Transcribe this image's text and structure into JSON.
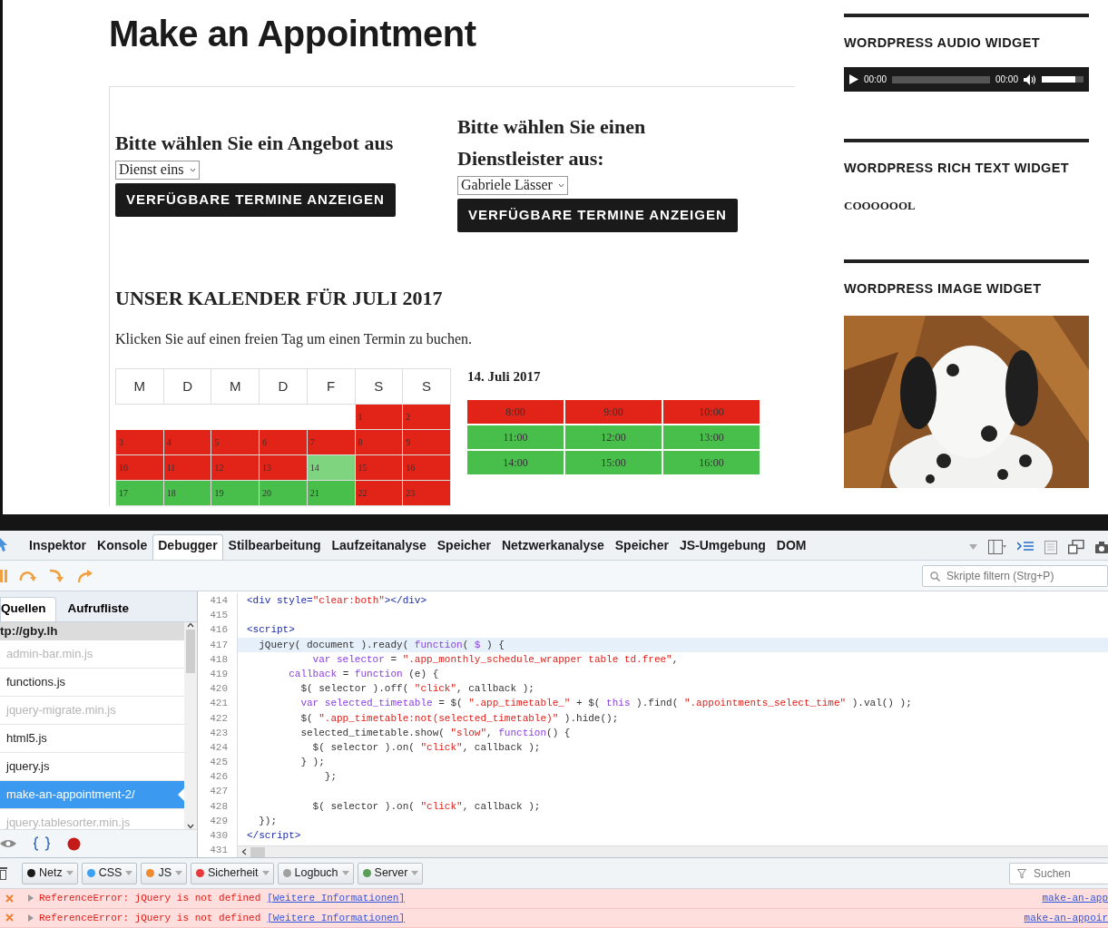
{
  "page": {
    "title": "Make an Appointment",
    "service_picker": {
      "heading": "Bitte wählen Sie ein Angebot aus",
      "select": "Dienst eins",
      "button": "VERFÜGBARE TERMINE ANZEIGEN"
    },
    "provider_picker": {
      "heading": "Bitte wählen Sie einen Dienstleister aus:",
      "select": "Gabriele Lässer",
      "button": "VERFÜGBARE TERMINE ANZEIGEN"
    },
    "calendar": {
      "heading": "UNSER KALENDER FÜR JULI 2017",
      "hint": "Klicken Sie auf einen freien Tag um einen Termin zu buchen.",
      "weekdays": [
        "M",
        "D",
        "M",
        "D",
        "F",
        "S",
        "S"
      ],
      "weeks": [
        [
          {
            "kind": "blank"
          },
          {
            "kind": "blank"
          },
          {
            "kind": "blank"
          },
          {
            "kind": "blank"
          },
          {
            "kind": "blank"
          },
          {
            "kind": "day",
            "day": "1",
            "available": false,
            "selected": false
          },
          {
            "kind": "day",
            "day": "2",
            "available": false,
            "selected": false
          }
        ],
        [
          {
            "kind": "day",
            "day": "3",
            "available": false,
            "selected": false
          },
          {
            "kind": "day",
            "day": "4",
            "available": false,
            "selected": false
          },
          {
            "kind": "day",
            "day": "5",
            "available": false,
            "selected": false
          },
          {
            "kind": "day",
            "day": "6",
            "available": false,
            "selected": false
          },
          {
            "kind": "day",
            "day": "7",
            "available": false,
            "selected": false
          },
          {
            "kind": "day",
            "day": "8",
            "available": false,
            "selected": false
          },
          {
            "kind": "day",
            "day": "9",
            "available": false,
            "selected": false
          }
        ],
        [
          {
            "kind": "day",
            "day": "10",
            "available": false,
            "selected": false
          },
          {
            "kind": "day",
            "day": "11",
            "available": false,
            "selected": false
          },
          {
            "kind": "day",
            "day": "12",
            "available": false,
            "selected": false
          },
          {
            "kind": "day",
            "day": "13",
            "available": false,
            "selected": false
          },
          {
            "kind": "day",
            "day": "14",
            "available": true,
            "selected": true
          },
          {
            "kind": "day",
            "day": "15",
            "available": false,
            "selected": false
          },
          {
            "kind": "day",
            "day": "16",
            "available": false,
            "selected": false
          }
        ],
        [
          {
            "kind": "day",
            "day": "17",
            "available": true,
            "selected": false
          },
          {
            "kind": "day",
            "day": "18",
            "available": true,
            "selected": false
          },
          {
            "kind": "day",
            "day": "19",
            "available": true,
            "selected": false
          },
          {
            "kind": "day",
            "day": "20",
            "available": true,
            "selected": false
          },
          {
            "kind": "day",
            "day": "21",
            "available": true,
            "selected": false
          },
          {
            "kind": "day",
            "day": "22",
            "available": false,
            "selected": false
          },
          {
            "kind": "day",
            "day": "23",
            "available": false,
            "selected": false
          }
        ]
      ]
    },
    "day_view": {
      "date": "14. Juli 2017",
      "slots": [
        {
          "time": "8:00",
          "available": false
        },
        {
          "time": "9:00",
          "available": false
        },
        {
          "time": "10:00",
          "available": false
        },
        {
          "time": "11:00",
          "available": true
        },
        {
          "time": "12:00",
          "available": true
        },
        {
          "time": "13:00",
          "available": true
        },
        {
          "time": "14:00",
          "available": true
        },
        {
          "time": "15:00",
          "available": true
        },
        {
          "time": "16:00",
          "available": true
        }
      ]
    }
  },
  "sidebar": {
    "widgets": [
      {
        "kind": "audio",
        "title": "WORDPRESS AUDIO WIDGET",
        "current_time": "00:00",
        "duration": "00:00",
        "volume": {
          "level": 0.8
        }
      },
      {
        "kind": "text",
        "title": "WORDPRESS RICH TEXT WIDGET",
        "text": "COOOOOOL"
      },
      {
        "title": "WORDPRESS IMAGE WIDGET"
      }
    ]
  },
  "devtools": {
    "tabs": [
      {
        "label": "Inspektor",
        "selected": false
      },
      {
        "label": "Konsole",
        "selected": false
      },
      {
        "label": "Debugger",
        "selected": true
      },
      {
        "label": "Stilbearbeitung",
        "selected": false
      },
      {
        "label": "Laufzeitanalyse",
        "selected": false
      },
      {
        "label": "Speicher",
        "selected": false
      },
      {
        "label": "Netzwerkanalyse",
        "selected": false
      },
      {
        "label": "Speicher",
        "selected": false
      },
      {
        "label": "JS-Umgebung",
        "selected": false
      },
      {
        "label": "DOM",
        "selected": false
      }
    ],
    "debugger": {
      "filter_placeholder": "Skripte filtern (Strg+P)",
      "side_tabs": [
        {
          "label": "Quellen",
          "selected": true
        },
        {
          "label": "Aufrufliste",
          "selected": false
        }
      ],
      "source_group": "tp://gby.lh",
      "sources": [
        {
          "name": "admin-bar.min.js",
          "dimmed": true,
          "selected": false
        },
        {
          "name": "functions.js",
          "dimmed": false,
          "selected": false
        },
        {
          "name": "jquery-migrate.min.js",
          "dimmed": true,
          "selected": false
        },
        {
          "name": "html5.js",
          "dimmed": false,
          "selected": false
        },
        {
          "name": "jquery.js",
          "dimmed": false,
          "selected": false
        },
        {
          "name": "make-an-appointment-2/",
          "dimmed": false,
          "selected": true
        },
        {
          "name": "jquery.tablesorter.min.js",
          "dimmed": true,
          "selected": false
        }
      ],
      "code": [
        {
          "number": "414",
          "highlighted": false,
          "tokens": [
            {
              "kind": "tag",
              "text": "<div style="
            },
            {
              "kind": "string",
              "text": "\"clear:both\""
            },
            {
              "kind": "tag",
              "text": "></div>"
            }
          ]
        },
        {
          "number": "415",
          "highlighted": false
        },
        {
          "number": "416",
          "highlighted": false,
          "tokens": [
            {
              "kind": "tag",
              "text": "<script>"
            }
          ]
        },
        {
          "number": "417",
          "highlighted": true,
          "tokens": [
            {
              "kind": "plain",
              "text": "  jQuery( document ).ready( "
            },
            {
              "kind": "keyword",
              "text": "function"
            },
            {
              "kind": "plain",
              "text": "( "
            },
            {
              "kind": "keyword",
              "text": "$"
            },
            {
              "kind": "plain",
              "text": " ) {"
            }
          ]
        },
        {
          "number": "418",
          "highlighted": false,
          "tokens": [
            {
              "kind": "keyword",
              "text": "           var selector"
            },
            {
              "kind": "plain",
              "text": " = "
            },
            {
              "kind": "string",
              "text": "\".app_monthly_schedule_wrapper table td.free\""
            },
            {
              "kind": "plain",
              "text": ","
            }
          ]
        },
        {
          "number": "419",
          "highlighted": false,
          "tokens": [
            {
              "kind": "keyword",
              "text": "       callback"
            },
            {
              "kind": "plain",
              "text": " = "
            },
            {
              "kind": "keyword",
              "text": "function"
            },
            {
              "kind": "plain",
              "text": " (e) {"
            }
          ]
        },
        {
          "number": "420",
          "highlighted": false,
          "tokens": [
            {
              "kind": "plain",
              "text": "         $( selector ).off( "
            },
            {
              "kind": "string",
              "text": "\"click\""
            },
            {
              "kind": "plain",
              "text": ", callback );"
            }
          ]
        },
        {
          "number": "421",
          "highlighted": false,
          "tokens": [
            {
              "kind": "keyword",
              "text": "         var selected_timetable"
            },
            {
              "kind": "plain",
              "text": " = $( "
            },
            {
              "kind": "string",
              "text": "\".app_timetable_\""
            },
            {
              "kind": "plain",
              "text": " + $( "
            },
            {
              "kind": "keyword",
              "text": "this"
            },
            {
              "kind": "plain",
              "text": " ).find( "
            },
            {
              "kind": "string",
              "text": "\".appointments_select_time\""
            },
            {
              "kind": "plain",
              "text": " ).val() );"
            }
          ]
        },
        {
          "number": "422",
          "highlighted": false,
          "tokens": [
            {
              "kind": "plain",
              "text": "         $( "
            },
            {
              "kind": "string",
              "text": "\".app_timetable:not(selected_timetable)\""
            },
            {
              "kind": "plain",
              "text": " ).hide();"
            }
          ]
        },
        {
          "number": "423",
          "highlighted": false,
          "tokens": [
            {
              "kind": "plain",
              "text": "         selected_timetable.show( "
            },
            {
              "kind": "string",
              "text": "\"slow\""
            },
            {
              "kind": "plain",
              "text": ", "
            },
            {
              "kind": "keyword",
              "text": "function"
            },
            {
              "kind": "plain",
              "text": "() {"
            }
          ]
        },
        {
          "number": "424",
          "highlighted": false,
          "tokens": [
            {
              "kind": "plain",
              "text": "           $( selector ).on( "
            },
            {
              "kind": "string",
              "text": "\"click\""
            },
            {
              "kind": "plain",
              "text": ", callback );"
            }
          ]
        },
        {
          "number": "425",
          "highlighted": false,
          "tokens": [
            {
              "kind": "plain",
              "text": "         } );"
            }
          ]
        },
        {
          "number": "426",
          "highlighted": false,
          "tokens": [
            {
              "kind": "plain",
              "text": "             };"
            }
          ]
        },
        {
          "number": "427",
          "highlighted": false
        },
        {
          "number": "428",
          "highlighted": false,
          "tokens": [
            {
              "kind": "plain",
              "text": "           $( selector ).on( "
            },
            {
              "kind": "string",
              "text": "\"click\""
            },
            {
              "kind": "plain",
              "text": ", callback );"
            }
          ]
        },
        {
          "number": "429",
          "highlighted": false,
          "tokens": [
            {
              "kind": "plain",
              "text": "  });"
            }
          ]
        },
        {
          "number": "430",
          "highlighted": false,
          "tokens": [
            {
              "kind": "tag",
              "text": "</script>"
            }
          ]
        },
        {
          "number": "431",
          "highlighted": false
        }
      ]
    },
    "console": {
      "filters": [
        {
          "label": "Netz",
          "color": "#1a1a1a"
        },
        {
          "label": "CSS",
          "color": "#3ea0f0"
        },
        {
          "label": "JS",
          "color": "#f08a30"
        },
        {
          "label": "Sicherheit",
          "color": "#e83a3a"
        },
        {
          "label": "Logbuch",
          "color": "#a0a0a0"
        },
        {
          "label": "Server",
          "color": "#5a9e5a"
        }
      ],
      "search_placeholder": "Suchen",
      "messages": [
        {
          "text": "ReferenceError: jQuery is not defined",
          "link": "[Weitere Informationen]",
          "source": "make-an-app"
        },
        {
          "text": "ReferenceError: jQuery is not defined",
          "link": "[Weitere Informationen]",
          "source": "make-an-appoir"
        }
      ]
    }
  }
}
